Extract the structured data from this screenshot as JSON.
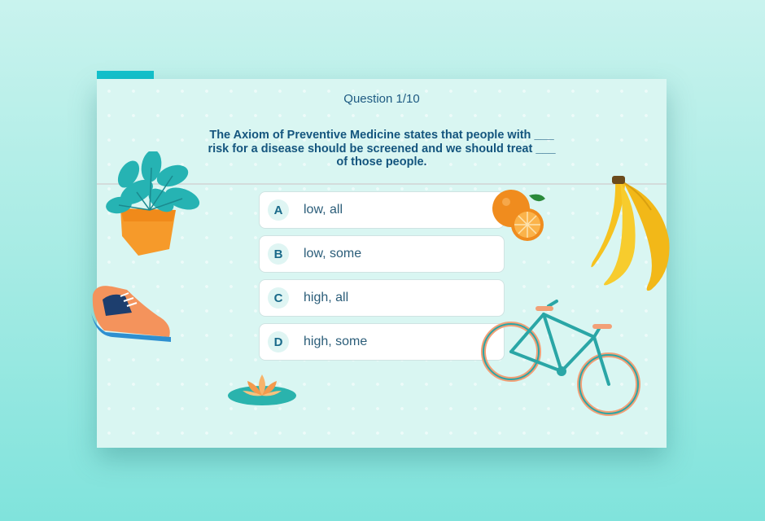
{
  "quiz": {
    "counter": "Question 1/10",
    "question": "The Axiom of Preventive Medicine states that people with ___ risk for a disease should be screened and we should treat ___ of those people.",
    "progress": 0.1,
    "answers": [
      {
        "letter": "A",
        "label": "low, all"
      },
      {
        "letter": "B",
        "label": "low, some"
      },
      {
        "letter": "C",
        "label": "high, all"
      },
      {
        "letter": "D",
        "label": "high, some"
      }
    ]
  },
  "decorations": [
    "potted-plant-icon",
    "sneaker-icon",
    "lotus-icon",
    "orange-icon",
    "banana-icon",
    "bicycle-icon"
  ],
  "colors": {
    "accent": "#13c1cc",
    "question_text": "#14557e",
    "card_bg": "#d9f6f2"
  }
}
